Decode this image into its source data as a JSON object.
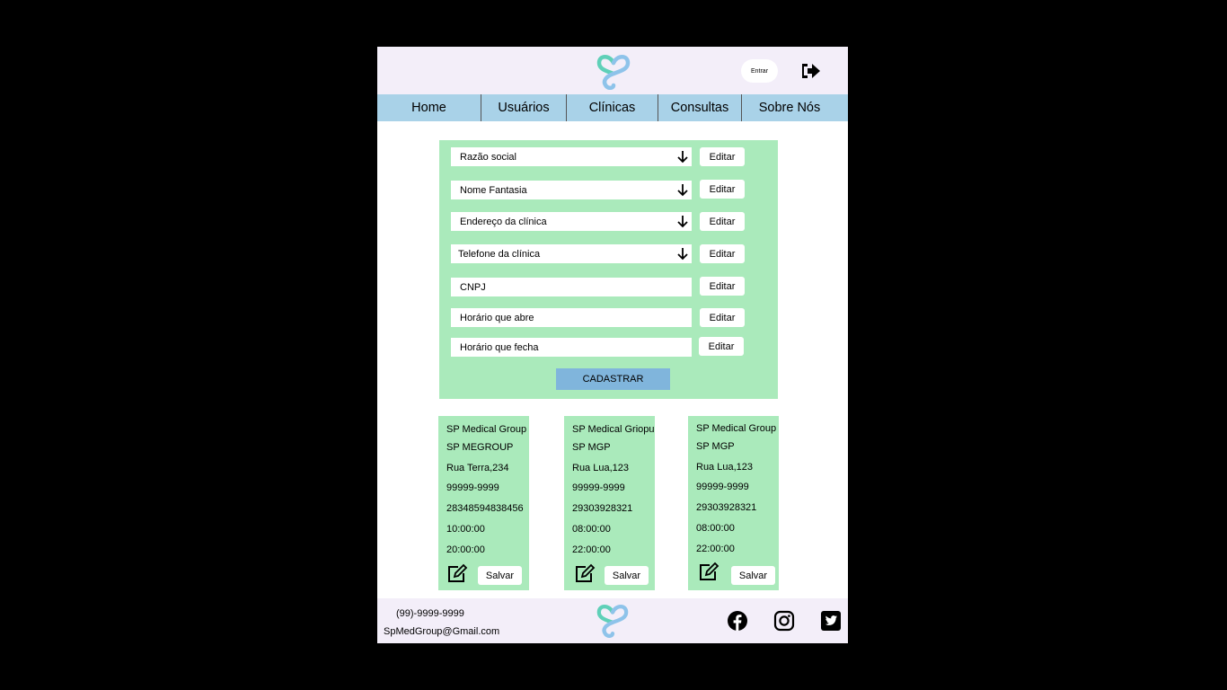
{
  "header": {
    "login_label": "Entrar",
    "logo": "sp-heart-logo",
    "logout_icon": "sign-out-icon"
  },
  "nav": {
    "items": [
      "Home",
      "Usuários",
      "Clínicas",
      "Consultas",
      "Sobre Nós"
    ]
  },
  "form": {
    "fields": [
      {
        "label": "Razão social",
        "dropdown": true
      },
      {
        "label": "Nome Fantasia",
        "dropdown": true
      },
      {
        "label": "Endereço da clínica",
        "dropdown": true
      },
      {
        "label": "Telefone da clínica",
        "dropdown": true
      },
      {
        "label": "CNPJ",
        "dropdown": false
      },
      {
        "label": "Horário que abre",
        "dropdown": false
      },
      {
        "label": "Horário que fecha",
        "dropdown": false
      }
    ],
    "edit_label": "Editar",
    "submit_label": "CADASTRAR"
  },
  "cards": [
    {
      "lines": [
        "SP Medical Group",
        "SP MEGROUP",
        "Rua Terra,234",
        "99999-9999",
        "28348594838456",
        "10:00:00",
        "20:00:00"
      ],
      "save_label": "Salvar"
    },
    {
      "lines": [
        "SP Medical Griopu",
        "SP MGP",
        "Rua Lua,123",
        "99999-9999",
        "29303928321",
        "08:00:00",
        "22:00:00"
      ],
      "save_label": "Salvar"
    },
    {
      "lines": [
        "SP Medical Group",
        "SP MGP",
        "Rua Lua,123",
        "99999-9999",
        "29303928321",
        "08:00:00",
        "22:00:00"
      ],
      "save_label": "Salvar"
    }
  ],
  "footer": {
    "phone": "(99)-9999-9999",
    "email": "SpMedGroup@Gmail.com",
    "social": [
      "facebook-icon",
      "instagram-icon",
      "twitter-icon"
    ]
  },
  "colors": {
    "header_bg": "#f3eef9",
    "nav_bg": "#a9d2e8",
    "panel_green": "#aaeabb",
    "submit_blue": "#80b5dc",
    "logo_teal": "#5fd0b8",
    "logo_blue": "#8ec3ea"
  }
}
